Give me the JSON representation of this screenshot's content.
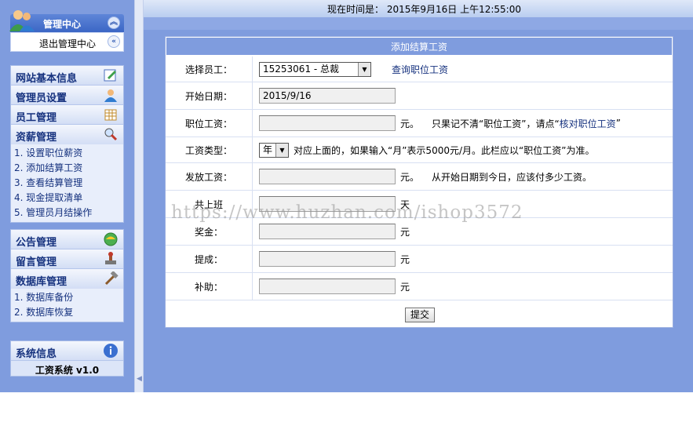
{
  "sidebar": {
    "admin_center": "管理中心",
    "logout": "退出管理中心",
    "group1": [
      {
        "label": "网站基本信息",
        "icon": "edit-icon"
      },
      {
        "label": "管理员设置",
        "icon": "user-icon"
      },
      {
        "label": "员工管理",
        "icon": "table-icon"
      },
      {
        "label": "资薪管理",
        "icon": "search-icon"
      }
    ],
    "salary_sub": [
      "1. 设置职位薪资",
      "2. 添加结算工资",
      "3. 查看结算管理",
      "4. 现金提取清单",
      "5. 管理员月结操作"
    ],
    "group2": [
      {
        "label": "公告管理",
        "icon": "globe-icon"
      },
      {
        "label": "留言管理",
        "icon": "stamp-icon"
      },
      {
        "label": "数据库管理",
        "icon": "hammer-icon"
      }
    ],
    "db_sub": [
      "1. 数据库备份",
      "2. 数据库恢复"
    ],
    "sysinfo": {
      "label": "系统信息",
      "version": "工资系统 v1.0"
    }
  },
  "topbar": {
    "time": "现在时间是： 2015年9月16日 上午12:55:00"
  },
  "form": {
    "title": "添加结算工资",
    "employee_label": "选择员工：",
    "employee_value": "15253061 - 总裁",
    "query_link": "查询职位工资",
    "start_label": "开始日期：",
    "start_value": "2015/9/16",
    "position_label": "职位工资：",
    "position_unit": "元。",
    "position_note_a": "只果记不清“职位工资”，请点“",
    "position_note_link": "核对职位工资",
    "position_note_b": "”",
    "type_label": "工资类型：",
    "type_value": "年",
    "type_note": "对应上面的，如果输入“月”表示5000元/月。此栏应以“职位工资”为准。",
    "issue_label": "发放工资：",
    "issue_unit": "元。",
    "issue_note": "从开始日期到今日，应该付多少工资。",
    "work_label": "共上班",
    "work_unit": "天",
    "bonus_label": "奖金：",
    "bonus_unit": "元",
    "commission_label": "提成：",
    "commission_unit": "元",
    "subsidy_label": "补助：",
    "subsidy_unit": "元",
    "submit": "提交"
  },
  "watermark": "https://www.huzhan.com/ishop3572"
}
